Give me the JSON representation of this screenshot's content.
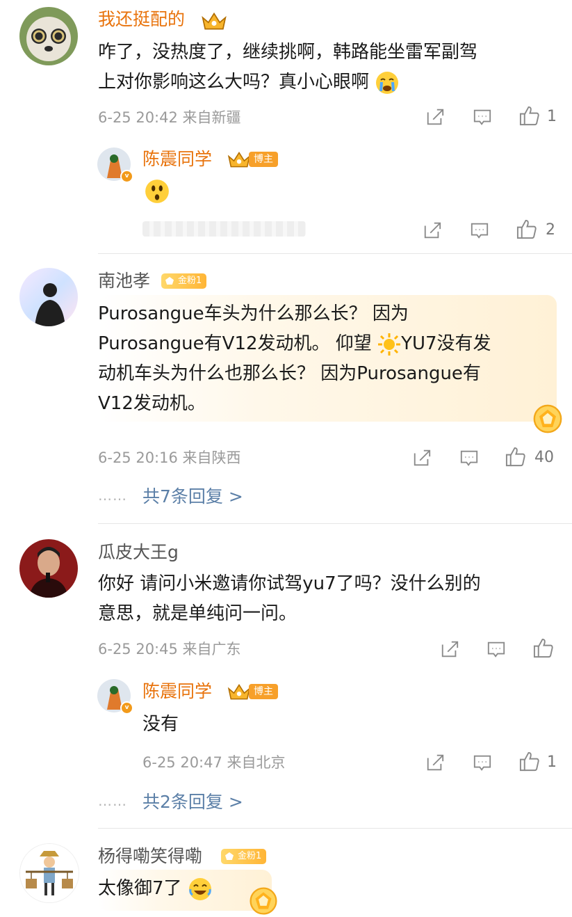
{
  "comments": [
    {
      "username": "我还挺配的",
      "text_line1": "咋了，没热度了，继续挑啊，韩路能坐雷军副驾",
      "text_line2": "上对你影响这么大吗？真小心眼啊",
      "meta": "6-25 20:42 来自新疆",
      "likes": "1",
      "reply": {
        "username": "陈震同学",
        "badge": "博主",
        "likes": "2"
      }
    },
    {
      "username": "南池孝",
      "fan_badge": "金粉1",
      "text_line1": "Purosangue车头为什么那么长？ 因为",
      "text_line2a": "Purosangue有V12发动机。 仰望",
      "text_line2b": "YU7没有发",
      "text_line3": "动机车头为什么也那么长？ 因为Purosangue有",
      "text_line4": "V12发动机。",
      "meta": "6-25 20:16 来自陕西",
      "likes": "40",
      "more_replies": "共7条回复 >"
    },
    {
      "username": "瓜皮大王g",
      "text_line1": "你好 请问小米邀请你试驾yu7了吗？没什么别的",
      "text_line2": "意思，就是单纯问一问。",
      "meta": "6-25 20:45 来自广东",
      "reply": {
        "username": "陈震同学",
        "badge": "博主",
        "text": "没有",
        "meta": "6-25 20:47 来自北京",
        "likes": "1"
      },
      "more_replies": "共2条回复 >"
    },
    {
      "username": "杨得嘞笑得嘞",
      "fan_badge": "金粉1",
      "text": "太像御7了"
    }
  ],
  "dots": "……",
  "icons": [
    "share-icon",
    "comment-icon",
    "like-icon",
    "crown-icon",
    "sun-emoji",
    "crying-emoji",
    "shocked-emoji",
    "laughing-emoji",
    "gold-medal-icon"
  ],
  "colors": {
    "username_orange": "#e8730c",
    "link_blue": "#5b7fa7",
    "meta_gray": "#9a9a9a",
    "badge_orange": "#f7a02a"
  }
}
